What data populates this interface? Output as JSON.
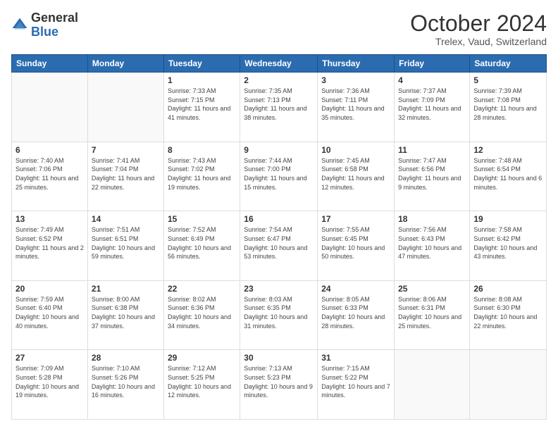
{
  "logo": {
    "general": "General",
    "blue": "Blue"
  },
  "header": {
    "month": "October 2024",
    "location": "Trelex, Vaud, Switzerland"
  },
  "days_of_week": [
    "Sunday",
    "Monday",
    "Tuesday",
    "Wednesday",
    "Thursday",
    "Friday",
    "Saturday"
  ],
  "weeks": [
    [
      {
        "day": "",
        "info": ""
      },
      {
        "day": "",
        "info": ""
      },
      {
        "day": "1",
        "info": "Sunrise: 7:33 AM\nSunset: 7:15 PM\nDaylight: 11 hours and 41 minutes."
      },
      {
        "day": "2",
        "info": "Sunrise: 7:35 AM\nSunset: 7:13 PM\nDaylight: 11 hours and 38 minutes."
      },
      {
        "day": "3",
        "info": "Sunrise: 7:36 AM\nSunset: 7:11 PM\nDaylight: 11 hours and 35 minutes."
      },
      {
        "day": "4",
        "info": "Sunrise: 7:37 AM\nSunset: 7:09 PM\nDaylight: 11 hours and 32 minutes."
      },
      {
        "day": "5",
        "info": "Sunrise: 7:39 AM\nSunset: 7:08 PM\nDaylight: 11 hours and 28 minutes."
      }
    ],
    [
      {
        "day": "6",
        "info": "Sunrise: 7:40 AM\nSunset: 7:06 PM\nDaylight: 11 hours and 25 minutes."
      },
      {
        "day": "7",
        "info": "Sunrise: 7:41 AM\nSunset: 7:04 PM\nDaylight: 11 hours and 22 minutes."
      },
      {
        "day": "8",
        "info": "Sunrise: 7:43 AM\nSunset: 7:02 PM\nDaylight: 11 hours and 19 minutes."
      },
      {
        "day": "9",
        "info": "Sunrise: 7:44 AM\nSunset: 7:00 PM\nDaylight: 11 hours and 15 minutes."
      },
      {
        "day": "10",
        "info": "Sunrise: 7:45 AM\nSunset: 6:58 PM\nDaylight: 11 hours and 12 minutes."
      },
      {
        "day": "11",
        "info": "Sunrise: 7:47 AM\nSunset: 6:56 PM\nDaylight: 11 hours and 9 minutes."
      },
      {
        "day": "12",
        "info": "Sunrise: 7:48 AM\nSunset: 6:54 PM\nDaylight: 11 hours and 6 minutes."
      }
    ],
    [
      {
        "day": "13",
        "info": "Sunrise: 7:49 AM\nSunset: 6:52 PM\nDaylight: 11 hours and 2 minutes."
      },
      {
        "day": "14",
        "info": "Sunrise: 7:51 AM\nSunset: 6:51 PM\nDaylight: 10 hours and 59 minutes."
      },
      {
        "day": "15",
        "info": "Sunrise: 7:52 AM\nSunset: 6:49 PM\nDaylight: 10 hours and 56 minutes."
      },
      {
        "day": "16",
        "info": "Sunrise: 7:54 AM\nSunset: 6:47 PM\nDaylight: 10 hours and 53 minutes."
      },
      {
        "day": "17",
        "info": "Sunrise: 7:55 AM\nSunset: 6:45 PM\nDaylight: 10 hours and 50 minutes."
      },
      {
        "day": "18",
        "info": "Sunrise: 7:56 AM\nSunset: 6:43 PM\nDaylight: 10 hours and 47 minutes."
      },
      {
        "day": "19",
        "info": "Sunrise: 7:58 AM\nSunset: 6:42 PM\nDaylight: 10 hours and 43 minutes."
      }
    ],
    [
      {
        "day": "20",
        "info": "Sunrise: 7:59 AM\nSunset: 6:40 PM\nDaylight: 10 hours and 40 minutes."
      },
      {
        "day": "21",
        "info": "Sunrise: 8:00 AM\nSunset: 6:38 PM\nDaylight: 10 hours and 37 minutes."
      },
      {
        "day": "22",
        "info": "Sunrise: 8:02 AM\nSunset: 6:36 PM\nDaylight: 10 hours and 34 minutes."
      },
      {
        "day": "23",
        "info": "Sunrise: 8:03 AM\nSunset: 6:35 PM\nDaylight: 10 hours and 31 minutes."
      },
      {
        "day": "24",
        "info": "Sunrise: 8:05 AM\nSunset: 6:33 PM\nDaylight: 10 hours and 28 minutes."
      },
      {
        "day": "25",
        "info": "Sunrise: 8:06 AM\nSunset: 6:31 PM\nDaylight: 10 hours and 25 minutes."
      },
      {
        "day": "26",
        "info": "Sunrise: 8:08 AM\nSunset: 6:30 PM\nDaylight: 10 hours and 22 minutes."
      }
    ],
    [
      {
        "day": "27",
        "info": "Sunrise: 7:09 AM\nSunset: 5:28 PM\nDaylight: 10 hours and 19 minutes."
      },
      {
        "day": "28",
        "info": "Sunrise: 7:10 AM\nSunset: 5:26 PM\nDaylight: 10 hours and 16 minutes."
      },
      {
        "day": "29",
        "info": "Sunrise: 7:12 AM\nSunset: 5:25 PM\nDaylight: 10 hours and 12 minutes."
      },
      {
        "day": "30",
        "info": "Sunrise: 7:13 AM\nSunset: 5:23 PM\nDaylight: 10 hours and 9 minutes."
      },
      {
        "day": "31",
        "info": "Sunrise: 7:15 AM\nSunset: 5:22 PM\nDaylight: 10 hours and 7 minutes."
      },
      {
        "day": "",
        "info": ""
      },
      {
        "day": "",
        "info": ""
      }
    ]
  ]
}
